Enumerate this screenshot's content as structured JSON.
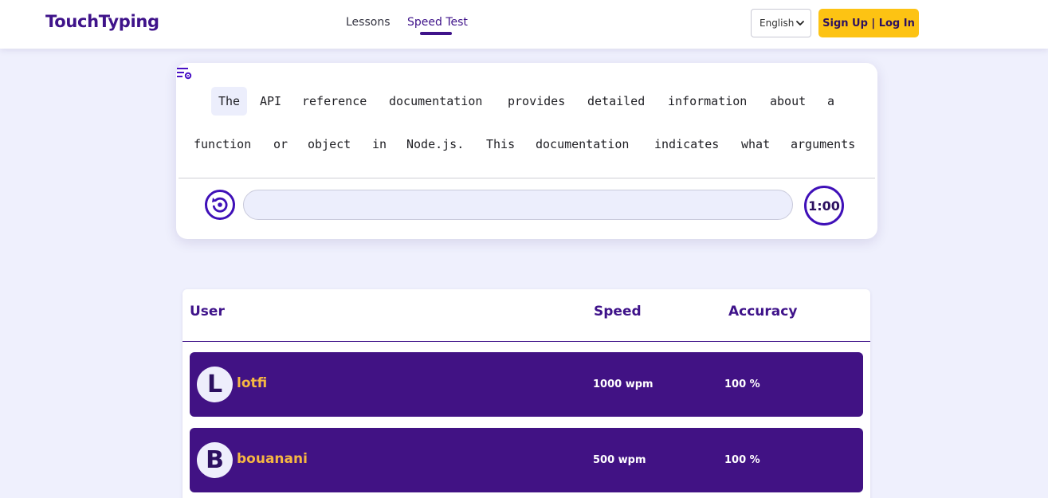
{
  "header": {
    "brand": "TouchTyping",
    "nav": {
      "lessons": "Lessons",
      "speed_test": "Speed Test"
    },
    "language": {
      "selected": "English"
    },
    "auth_button": "Sign Up | Log In"
  },
  "typing": {
    "line1": [
      "The",
      "API",
      "reference",
      "documentation",
      "provides",
      "detailed",
      "information",
      "about",
      "a"
    ],
    "line2": [
      "function",
      "or",
      "object",
      "in",
      "Node.js.",
      "This",
      "documentation",
      "indicates",
      "what",
      "arguments"
    ],
    "input": {
      "value": "",
      "placeholder": ""
    },
    "timer": "1:00"
  },
  "leaderboard": {
    "headers": {
      "user": "User",
      "speed": "Speed",
      "accuracy": "Accuracy"
    },
    "rows": [
      {
        "initial": "L",
        "name": "lotfi",
        "speed": "1000 wpm",
        "accuracy": "100 %"
      },
      {
        "initial": "B",
        "name": "bouanani",
        "speed": "500 wpm",
        "accuracy": "100 %"
      }
    ]
  },
  "colors": {
    "brand": "#3f138a",
    "accent": "#fdc313",
    "row_bg": "#411284",
    "name": "#f6b742",
    "page_bg": "#eff0fd"
  },
  "icons": {
    "settings": "settings-sliders-icon",
    "restart": "restart-icon",
    "dropdown": "chevron-down-icon"
  }
}
